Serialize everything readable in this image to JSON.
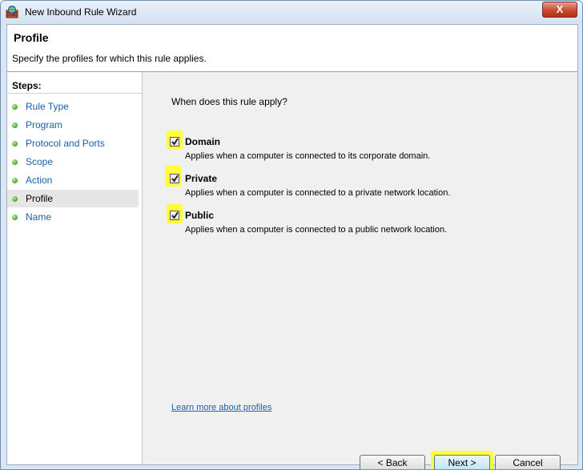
{
  "window": {
    "title": "New Inbound Rule Wizard",
    "close_glyph": "X"
  },
  "header": {
    "title": "Profile",
    "subtitle": "Specify the profiles for which this rule applies."
  },
  "steps": {
    "title": "Steps:",
    "items": [
      {
        "label": "Rule Type"
      },
      {
        "label": "Program"
      },
      {
        "label": "Protocol and Ports"
      },
      {
        "label": "Scope"
      },
      {
        "label": "Action"
      },
      {
        "label": "Profile",
        "current": true
      },
      {
        "label": "Name"
      }
    ]
  },
  "main": {
    "question": "When does this rule apply?",
    "options": [
      {
        "label": "Domain",
        "description": "Applies when a computer is connected to its corporate domain.",
        "checked": true
      },
      {
        "label": "Private",
        "description": "Applies when a computer is connected to a private network location.",
        "checked": true
      },
      {
        "label": "Public",
        "description": "Applies when a computer is connected to a public network location.",
        "checked": true
      }
    ],
    "learn_more": "Learn more about profiles"
  },
  "buttons": {
    "back": "< Back",
    "next": "Next >",
    "cancel": "Cancel"
  },
  "colors": {
    "highlight": "#ffff3a",
    "link": "#1f5eb0",
    "step_dot": "#4da82f"
  }
}
